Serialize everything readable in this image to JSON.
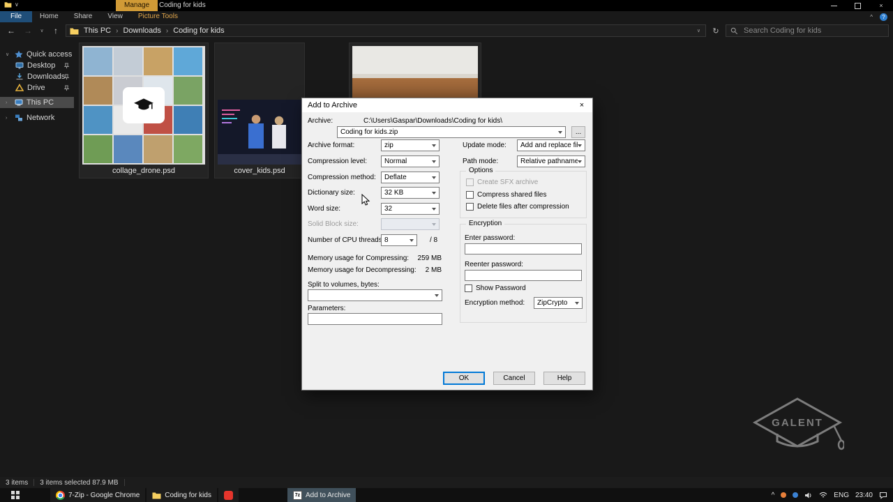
{
  "titlebar": {
    "manage_tab": "Manage",
    "window_title": "Coding for kids"
  },
  "ribbon": {
    "file_tab": "File",
    "tabs": [
      "Home",
      "Share",
      "View"
    ],
    "contextual_tab": "Picture Tools"
  },
  "address": {
    "crumbs": [
      "This PC",
      "Downloads",
      "Coding for kids"
    ],
    "search_placeholder": "Search Coding for kids"
  },
  "sidebar": {
    "items": [
      {
        "label": "Quick access"
      },
      {
        "label": "Desktop"
      },
      {
        "label": "Downloads"
      },
      {
        "label": "Drive"
      },
      {
        "label": "This PC"
      },
      {
        "label": "Network"
      }
    ]
  },
  "files": [
    {
      "name": "collage_drone.psd"
    },
    {
      "name": "cover_kids.psd"
    }
  ],
  "dialog": {
    "title": "Add to Archive",
    "archive_label": "Archive:",
    "archive_path": "C:\\Users\\Gaspar\\Downloads\\Coding for kids\\",
    "archive_name": "Coding for kids.zip",
    "browse": "...",
    "rows": {
      "format_label": "Archive format:",
      "format_value": "zip",
      "level_label": "Compression level:",
      "level_value": "Normal",
      "method_label": "Compression method:",
      "method_value": "Deflate",
      "dict_label": "Dictionary size:",
      "dict_value": "32 KB",
      "word_label": "Word size:",
      "word_value": "32",
      "solid_label": "Solid Block size:",
      "solid_value": "",
      "threads_label": "Number of CPU threads:",
      "threads_value": "8",
      "threads_suffix": "/ 8",
      "mem_c_label": "Memory usage for Compressing:",
      "mem_c_value": "259 MB",
      "mem_d_label": "Memory usage for Decompressing:",
      "mem_d_value": "2 MB",
      "split_label": "Split to volumes, bytes:",
      "params_label": "Parameters:"
    },
    "right": {
      "update_label": "Update mode:",
      "update_value": "Add and replace files",
      "pathmode_label": "Path mode:",
      "pathmode_value": "Relative pathnames",
      "options_title": "Options",
      "sfx_label": "Create SFX archive",
      "shared_label": "Compress shared files",
      "delete_label": "Delete files after compression",
      "encryption_title": "Encryption",
      "pwd1_label": "Enter password:",
      "pwd2_label": "Reenter password:",
      "showpwd_label": "Show Password",
      "encmethod_label": "Encryption method:",
      "encmethod_value": "ZipCrypto"
    },
    "buttons": {
      "ok": "OK",
      "cancel": "Cancel",
      "help": "Help"
    }
  },
  "statusbar": {
    "count": "3 items",
    "selection": "3 items selected 87.9 MB"
  },
  "taskbar": {
    "buttons": [
      {
        "label": "7-Zip - Google Chrome"
      },
      {
        "label": "Coding for kids"
      },
      {
        "label": "Add to Archive"
      }
    ],
    "tray": {
      "language": "ENG",
      "time": "23:40"
    }
  },
  "watermark": "GALENT",
  "icons": {
    "back": "←",
    "forward": "→",
    "up": "↑",
    "chevron_down": "∨",
    "chevron_sep": "›",
    "refresh": "↻",
    "close": "×",
    "help": "?",
    "tray_expand": "^",
    "zip_badge": "7z"
  }
}
